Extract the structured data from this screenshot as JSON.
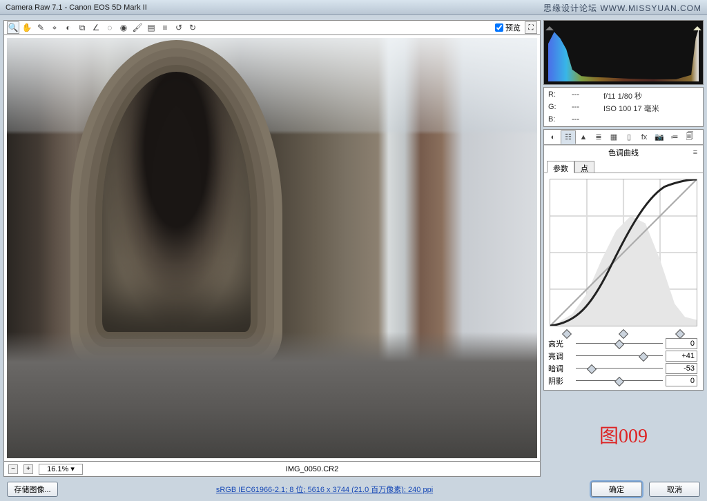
{
  "app_title": "Camera Raw 7.1 -  Canon EOS 5D Mark II",
  "watermark": "思缘设计论坛  WWW.MISSYUAN.COM",
  "toolbar": {
    "preview_label": "预览",
    "preview_checked": true
  },
  "zoom": {
    "level": "16.1%",
    "filename": "IMG_0050.CR2"
  },
  "meta": {
    "r_label": "R:",
    "r_val": "---",
    "g_label": "G:",
    "g_val": "---",
    "b_label": "B:",
    "b_val": "---",
    "exposure": "f/11   1/80 秒",
    "iso": "ISO 100   17 毫米"
  },
  "panels": [
    {
      "id": "basic",
      "title": "基本"
    },
    {
      "id": "tone-curve",
      "title": "色调曲线"
    },
    {
      "id": "detail",
      "title": "细节"
    },
    {
      "id": "hsl",
      "title": "HSL/灰度"
    },
    {
      "id": "split",
      "title": "分离色调"
    },
    {
      "id": "lens",
      "title": "镜头校正"
    },
    {
      "id": "fx",
      "title": "效果"
    },
    {
      "id": "cal",
      "title": "相机校准"
    },
    {
      "id": "presets",
      "title": "预设"
    },
    {
      "id": "snap",
      "title": "快照"
    }
  ],
  "tone_curve_panel_title": "色调曲线",
  "curve_tabs": {
    "params": "参数",
    "points": "点"
  },
  "sliders": {
    "highlights": {
      "label": "高光",
      "value": "0",
      "pos": 50
    },
    "lights": {
      "label": "亮调",
      "value": "+41",
      "pos": 78
    },
    "darks": {
      "label": "暗调",
      "value": "-53",
      "pos": 18
    },
    "shadows": {
      "label": "阴影",
      "value": "0",
      "pos": 50
    }
  },
  "annotation": "图009",
  "bottom": {
    "save_image": "存储图像...",
    "workflow": "sRGB IEC61966-2.1; 8 位; 5616 x 3744 (21.0 百万像素); 240 ppi",
    "ok": "确定",
    "cancel": "取消"
  }
}
